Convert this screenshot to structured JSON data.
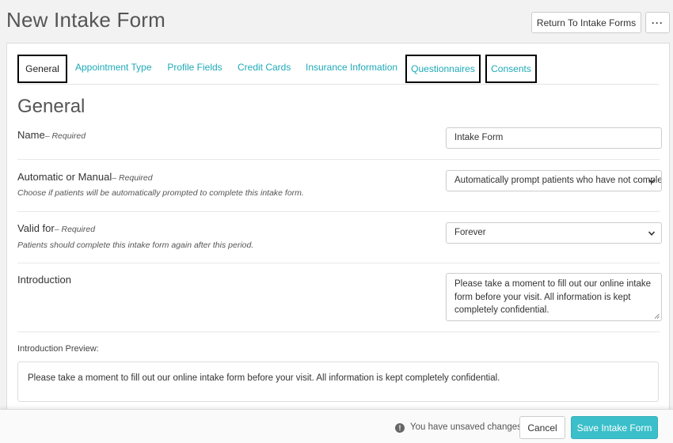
{
  "header": {
    "title": "New Intake Form",
    "return_button": "Return To Intake Forms",
    "more_button": "···"
  },
  "tabs": [
    {
      "label": "General",
      "active": true
    },
    {
      "label": "Appointment Type"
    },
    {
      "label": "Profile Fields"
    },
    {
      "label": "Credit Cards"
    },
    {
      "label": "Insurance Information"
    },
    {
      "label": "Questionnaires"
    },
    {
      "label": "Consents"
    }
  ],
  "section": {
    "title": "General"
  },
  "fields": {
    "name": {
      "label": "Name",
      "required": "– Required",
      "value": "Intake Form"
    },
    "automatic": {
      "label": "Automatic or Manual",
      "required": "– Required",
      "help": "Choose if patients will be automatically prompted to complete this intake form.",
      "value": "Automatically prompt patients who have not completed this form"
    },
    "valid_for": {
      "label": "Valid for",
      "required": "– Required",
      "help": "Patients should complete this intake form again after this period.",
      "value": "Forever"
    },
    "introduction": {
      "label": "Introduction",
      "value": "Please take a moment to fill out our online intake form before your visit. All information is kept completely confidential."
    }
  },
  "preview": {
    "label": "Introduction Preview:",
    "text": "Please take a moment to fill out our online intake form before your visit. All information is kept completely confidential."
  },
  "footer": {
    "info_icon": "!",
    "unsaved_text": "You have unsaved changes",
    "cancel": "Cancel",
    "save": "Save Intake Form"
  },
  "colors": {
    "accent": "#3bbfca",
    "tab_link": "#1eaab8"
  }
}
